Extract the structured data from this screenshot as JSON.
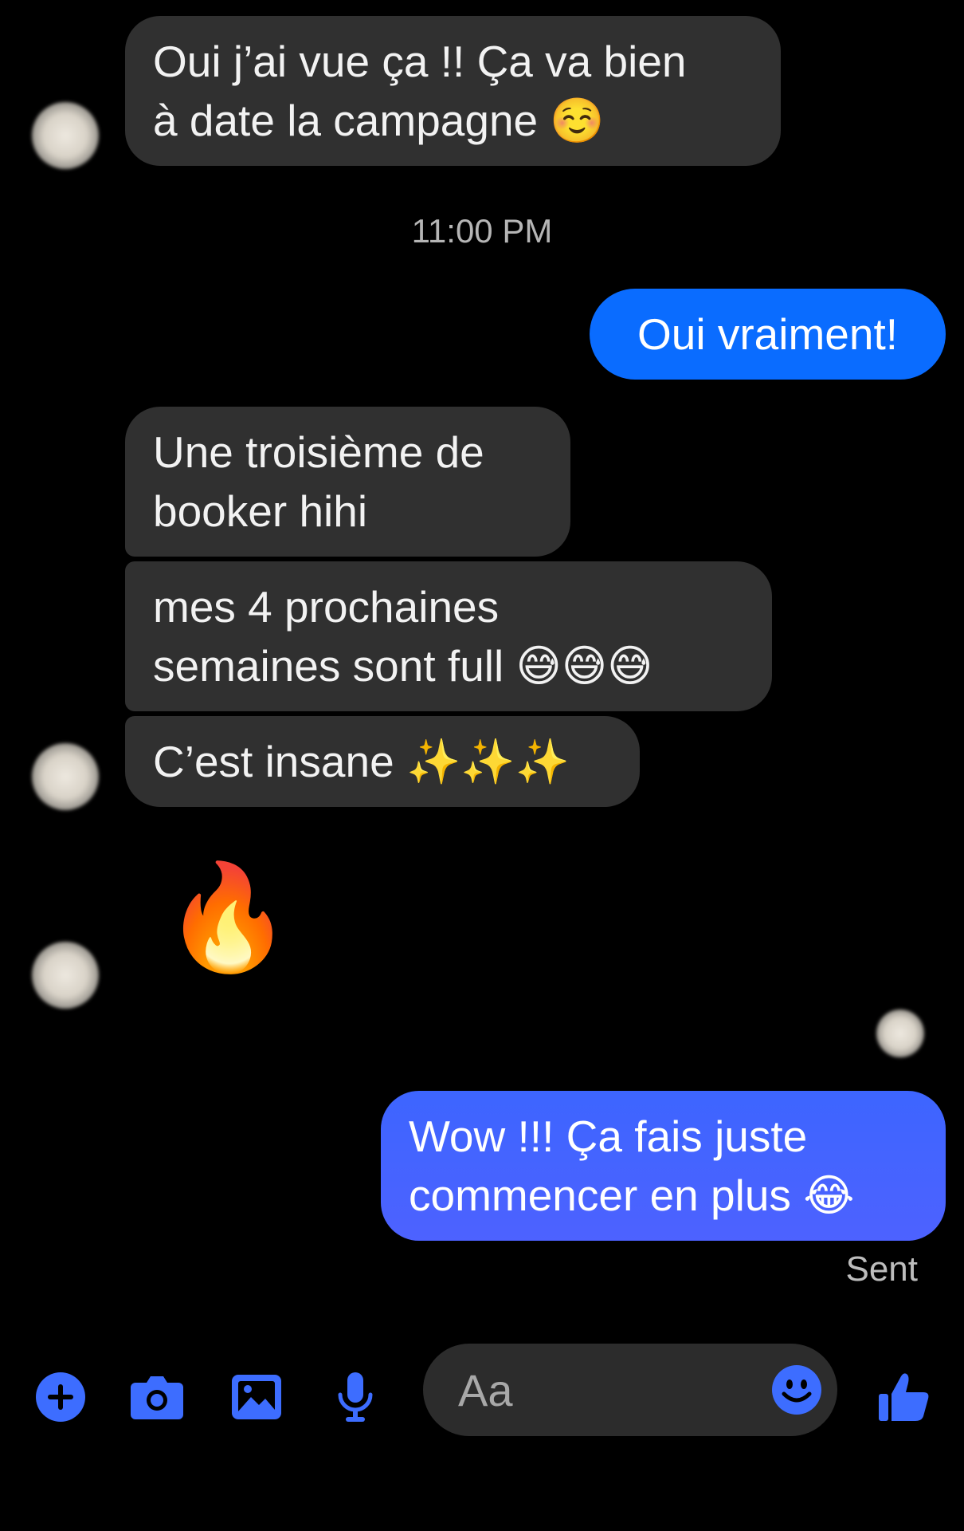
{
  "thread": {
    "timestamp": "11:00 PM",
    "messages": [
      {
        "id": "m1",
        "direction": "incoming",
        "lines": [
          "Oui j’ai vue ça !! Ça va bien",
          "à date la campagne ☺️"
        ]
      },
      {
        "id": "m2",
        "direction": "outgoing",
        "lines": [
          "Oui vraiment!"
        ]
      },
      {
        "id": "m3",
        "direction": "incoming",
        "lines": [
          "Une troisième de",
          "booker hihi"
        ]
      },
      {
        "id": "m4",
        "direction": "incoming",
        "lines": [
          "mes 4 prochaines",
          "semaines sont full 😅😅😅"
        ]
      },
      {
        "id": "m5",
        "direction": "incoming",
        "lines": [
          "C’est insane ✨✨✨"
        ]
      },
      {
        "id": "m6",
        "direction": "incoming",
        "lines": [
          "🔥"
        ]
      },
      {
        "id": "m7",
        "direction": "outgoing",
        "lines": [
          "Wow !!! Ça fais juste",
          "commencer en plus 😂"
        ]
      }
    ],
    "status": "Sent"
  },
  "composer": {
    "placeholder": "Aa",
    "icons": [
      "plus-circle-icon",
      "camera-icon",
      "image-icon",
      "microphone-icon",
      "emoji-icon",
      "thumbs-up-icon"
    ]
  },
  "colors": {
    "background": "#000000",
    "incoming_bubble": "#303030",
    "outgoing_bubble_top": "#0a6cff",
    "outgoing_bubble_bottom": "#4a62ff",
    "accent": "#3d6dff"
  }
}
